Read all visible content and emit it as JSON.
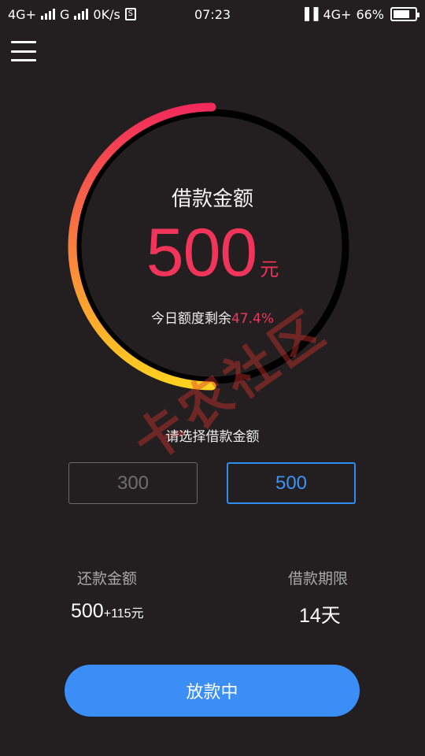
{
  "status_bar": {
    "network_1": "4G+",
    "network_2": "G",
    "speed": "0K/s",
    "sim_badge": "S",
    "time": "07:23",
    "network_3": "4G+",
    "battery": "66%"
  },
  "gauge": {
    "title": "借款金额",
    "amount": "500",
    "unit": "元",
    "remaining_label": "今日额度剩余",
    "remaining_percent": "47.4%",
    "progress": 0.5,
    "colors": {
      "start": "#f22a5c",
      "end": "#ffd21f",
      "track": "#000000"
    }
  },
  "watermark": {
    "text": "卡农社区"
  },
  "selection": {
    "label": "请选择借款金额",
    "options": [
      "300",
      "500"
    ],
    "selected": "500"
  },
  "repay": {
    "amount_label": "还款金额",
    "amount_main": "500",
    "amount_extra": "+115元",
    "term_label": "借款期限",
    "term_value": "14天"
  },
  "action": {
    "label": "放款中"
  },
  "icons": [
    "menu-icon",
    "signal-icon",
    "sim-icon",
    "vibrate-icon",
    "battery-icon"
  ]
}
